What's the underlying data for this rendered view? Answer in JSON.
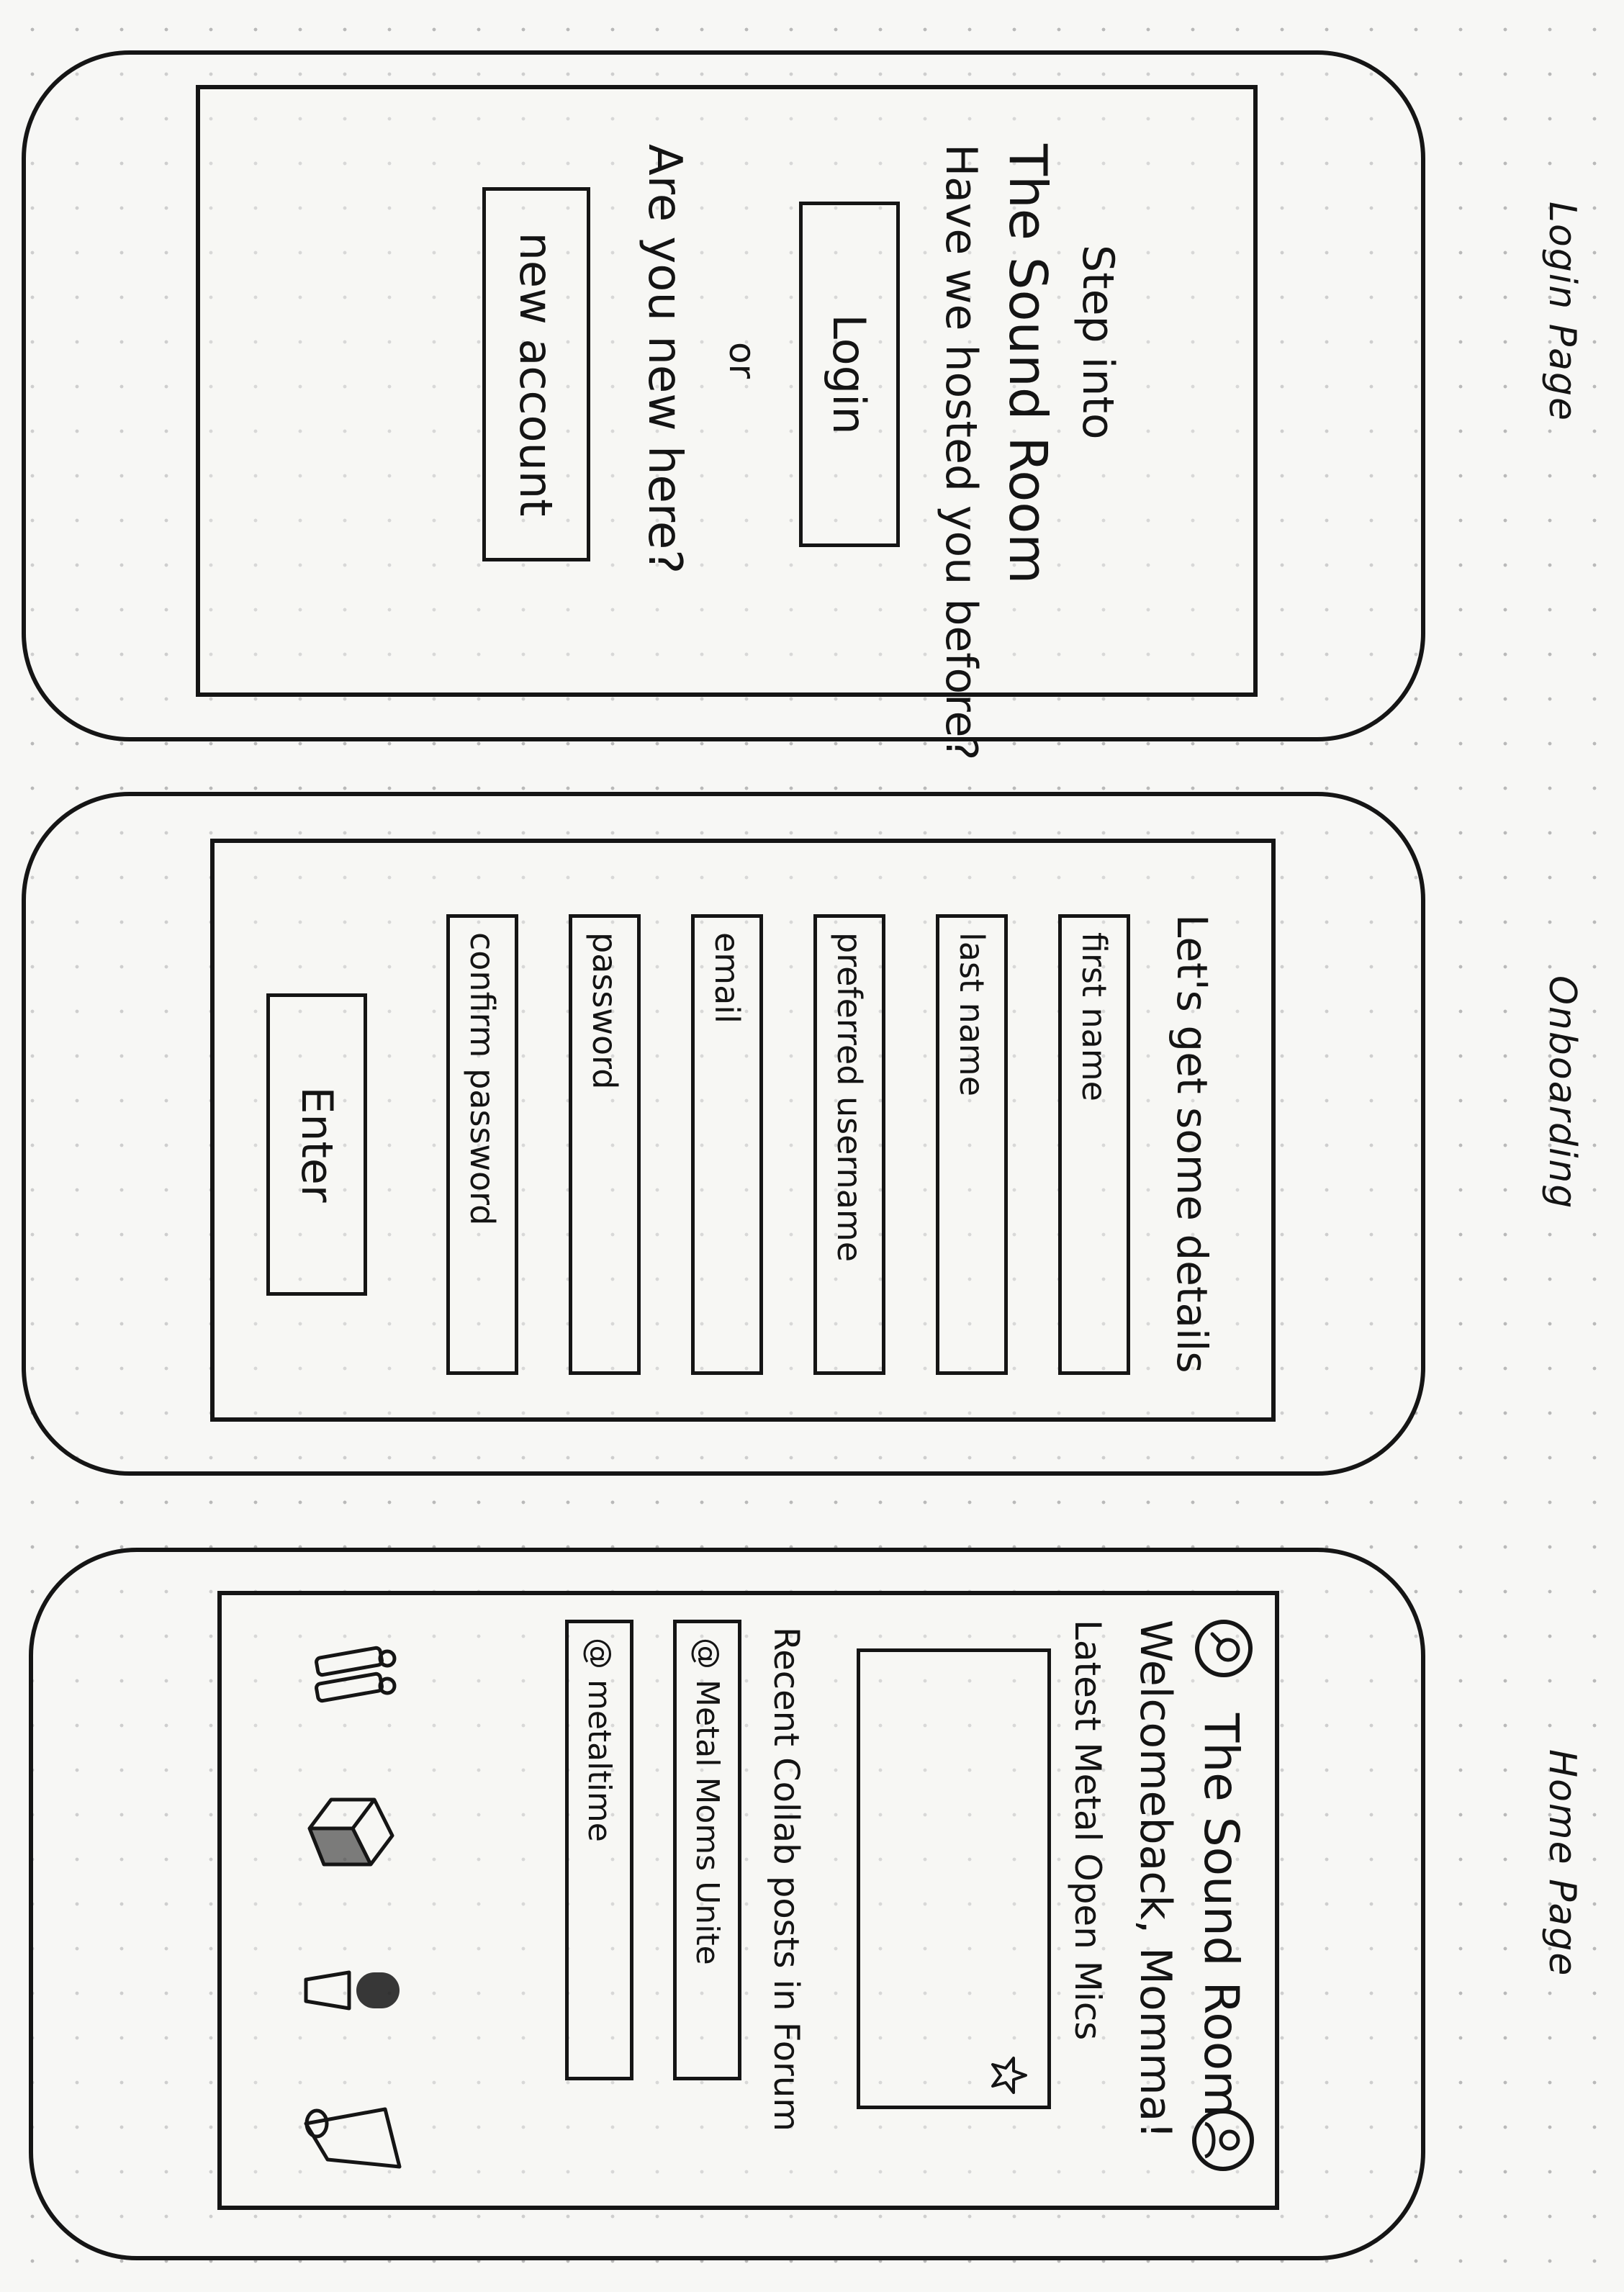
{
  "labels": {
    "login_page": "Login Page",
    "onboarding": "Onboarding",
    "home_page": "Home Page"
  },
  "login": {
    "heading_line1": "Step into",
    "heading_line2": "The Sound Room",
    "question": "Have we hosted you before?",
    "login_button": "Login",
    "or": "or",
    "new_question": "Are you new here?",
    "new_account_button": "new account"
  },
  "onboarding": {
    "heading": "Let's get some details",
    "fields": {
      "first_name": "first name",
      "last_name": "last name",
      "preferred_username": "preferred username",
      "email": "email",
      "password": "password",
      "confirm_password": "confirm password"
    },
    "enter_button": "Enter"
  },
  "home": {
    "app_title": "The Sound Room",
    "welcome": "Welcomeback, Momma!",
    "open_mics_heading": "Latest Metal Open Mics",
    "forum_heading": "Recent Collab posts in Forum",
    "forum_posts": [
      "@ Metal Moms Unite",
      "@ metaltime"
    ],
    "icons": {
      "search": "search-icon",
      "profile": "profile-icon",
      "favorite": "star-icon",
      "nav": [
        "guitar-icon",
        "music-box-icon",
        "microphone-icon",
        "speaker-icon"
      ]
    }
  },
  "colors": {
    "ink": "#141414",
    "paper": "#f7f7f5",
    "dots": "#b9b9b9"
  }
}
